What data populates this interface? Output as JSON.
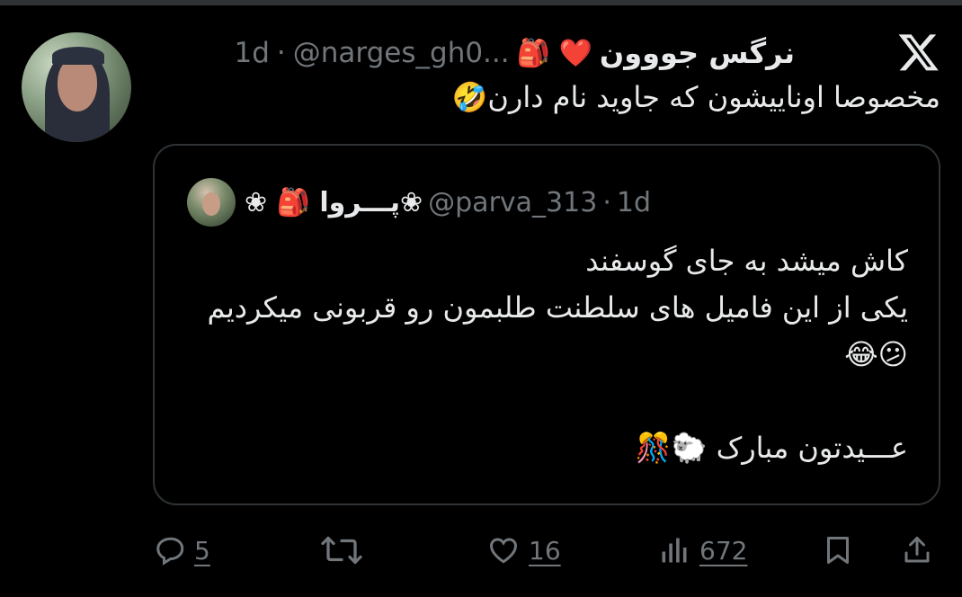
{
  "tweet": {
    "display_name": "نرگس جووون",
    "name_emojis": "🎒 ❤️",
    "handle": "@narges_gh0...",
    "time_sep": "·",
    "time": "1d",
    "text": "مخصوصا اوناییشون که جاوید نام دارن🤣"
  },
  "quote": {
    "display_name": "❀پـــروا 🎒 ❀",
    "handle": "@parva_313",
    "time_sep": "·",
    "time": "1d",
    "text": "کاش میشد به جای گوسفند\nیکی از این فامیل های سلطنت طلبمون رو قربونی میکردیم 😕😂\n\nعـــیدتون مبارک 🐑🎊"
  },
  "actions": {
    "reply_icon": "reply-icon",
    "reply_count": "5",
    "retweet_icon": "retweet-icon",
    "like_icon": "heart-icon",
    "like_count": "16",
    "views_icon": "views-icon",
    "views_count": "672",
    "bookmark_icon": "bookmark-icon",
    "share_icon": "share-icon"
  },
  "colors": {
    "background": "#000000",
    "text": "#e7e9ea",
    "muted": "#71767b",
    "border": "#2f3336"
  }
}
